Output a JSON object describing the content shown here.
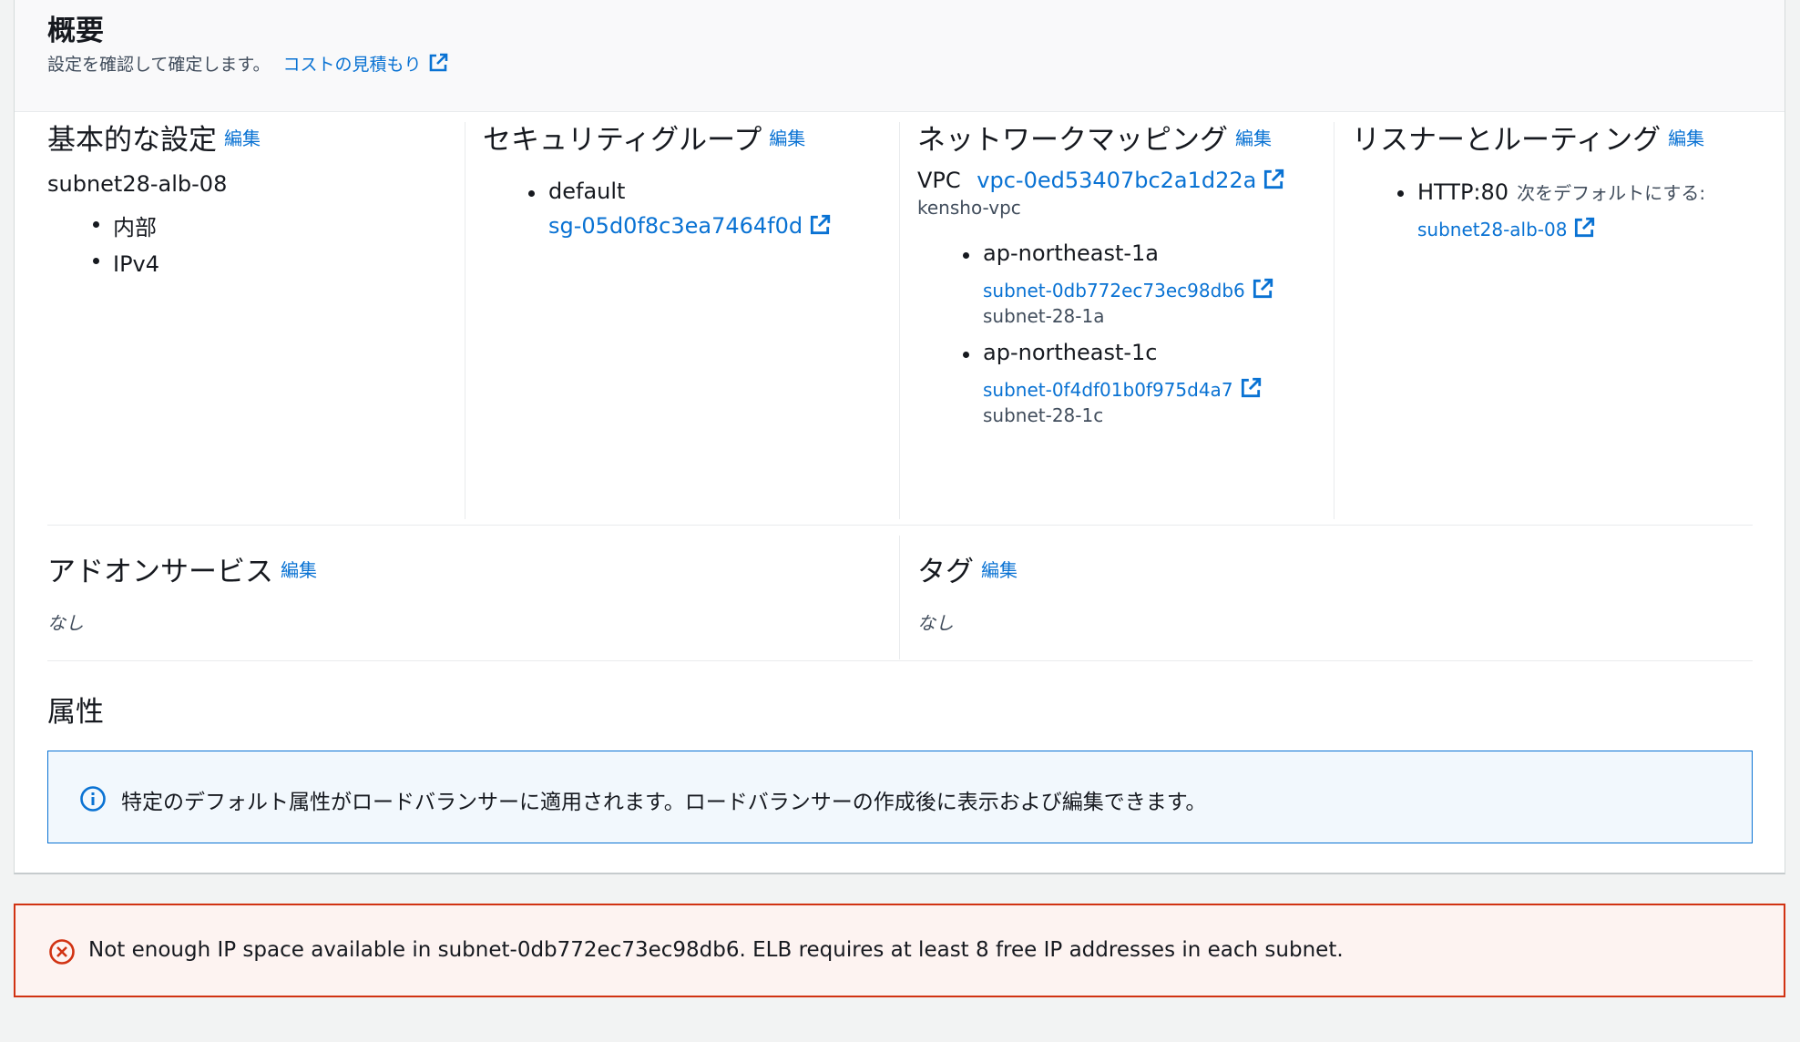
{
  "header": {
    "title": "概要",
    "subtitle": "設定を確認して確定します。",
    "cost_link": "コストの見積もり"
  },
  "basic": {
    "title": "基本的な設定",
    "edit": "編集",
    "name": "subnet28-alb-08",
    "items": [
      "内部",
      "IPv4"
    ]
  },
  "security": {
    "title": "セキュリティグループ",
    "edit": "編集",
    "group_name": "default",
    "group_id": "sg-05d0f8c3ea7464f0d"
  },
  "network": {
    "title": "ネットワークマッピング",
    "edit": "編集",
    "vpc_label": "VPC",
    "vpc_id": "vpc-0ed53407bc2a1d22a",
    "vpc_name": "kensho-vpc",
    "zones": [
      {
        "az": "ap-northeast-1a",
        "subnet_id": "subnet-0db772ec73ec98db6",
        "subnet_name": "subnet-28-1a"
      },
      {
        "az": "ap-northeast-1c",
        "subnet_id": "subnet-0f4df01b0f975d4a7",
        "subnet_name": "subnet-28-1c"
      }
    ]
  },
  "listener": {
    "title": "リスナーとルーティング",
    "edit": "編集",
    "protocol": "HTTP:80",
    "default_text": "次をデフォルトにする:",
    "target": "subnet28-alb-08"
  },
  "addon": {
    "title": "アドオンサービス",
    "edit": "編集",
    "value": "なし"
  },
  "tags": {
    "title": "タグ",
    "edit": "編集",
    "value": "なし"
  },
  "attributes": {
    "title": "属性",
    "info": "特定のデフォルト属性がロードバランサーに適用されます。ロードバランサーの作成後に表示および編集できます。"
  },
  "error": {
    "message": "Not enough IP space available in subnet-0db772ec73ec98db6. ELB requires at least 8 free IP addresses in each subnet."
  },
  "colors": {
    "link": "#0972d3",
    "error": "#d13212",
    "info_bg": "#f2f8fd"
  }
}
